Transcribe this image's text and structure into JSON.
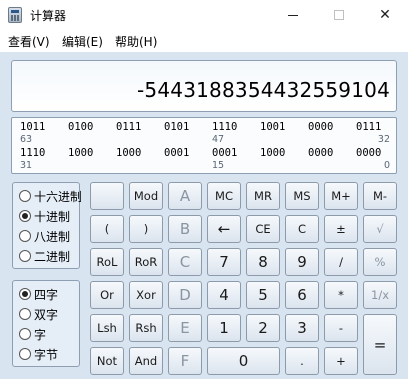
{
  "window": {
    "title": "计算器"
  },
  "menu": [
    "查看(V)",
    "编辑(E)",
    "帮助(H)"
  ],
  "display": {
    "value": "-5443188354432559104"
  },
  "bits": {
    "row1": [
      "1011",
      "0100",
      "0111",
      "0101",
      "1110",
      "1001",
      "0000",
      "0111"
    ],
    "row1_labels": {
      "left": "63",
      "mid": "47",
      "right": "32"
    },
    "row2": [
      "1110",
      "1000",
      "1000",
      "0001",
      "0001",
      "1000",
      "0000",
      "0000"
    ],
    "row2_labels": {
      "left": "31",
      "mid": "15",
      "right": "0"
    }
  },
  "base_options": [
    {
      "label": "十六进制",
      "checked": false
    },
    {
      "label": "十进制",
      "checked": true
    },
    {
      "label": "八进制",
      "checked": false
    },
    {
      "label": "二进制",
      "checked": false
    }
  ],
  "word_options": [
    {
      "label": "四字",
      "checked": true
    },
    {
      "label": "双字",
      "checked": false
    },
    {
      "label": "字",
      "checked": false
    },
    {
      "label": "字节",
      "checked": false
    }
  ],
  "keys": [
    [
      "",
      "Mod",
      "A",
      "MC",
      "MR",
      "MS",
      "M+",
      "M-"
    ],
    [
      "(",
      ")",
      "B",
      "←",
      "CE",
      "C",
      "±",
      "√"
    ],
    [
      "RoL",
      "RoR",
      "C",
      "7",
      "8",
      "9",
      "/",
      "%"
    ],
    [
      "Or",
      "Xor",
      "D",
      "4",
      "5",
      "6",
      "*",
      "1/x"
    ],
    [
      "Lsh",
      "Rsh",
      "E",
      "1",
      "2",
      "3",
      "-",
      "="
    ],
    [
      "Not",
      "And",
      "F",
      "0",
      ".",
      "+"
    ]
  ]
}
